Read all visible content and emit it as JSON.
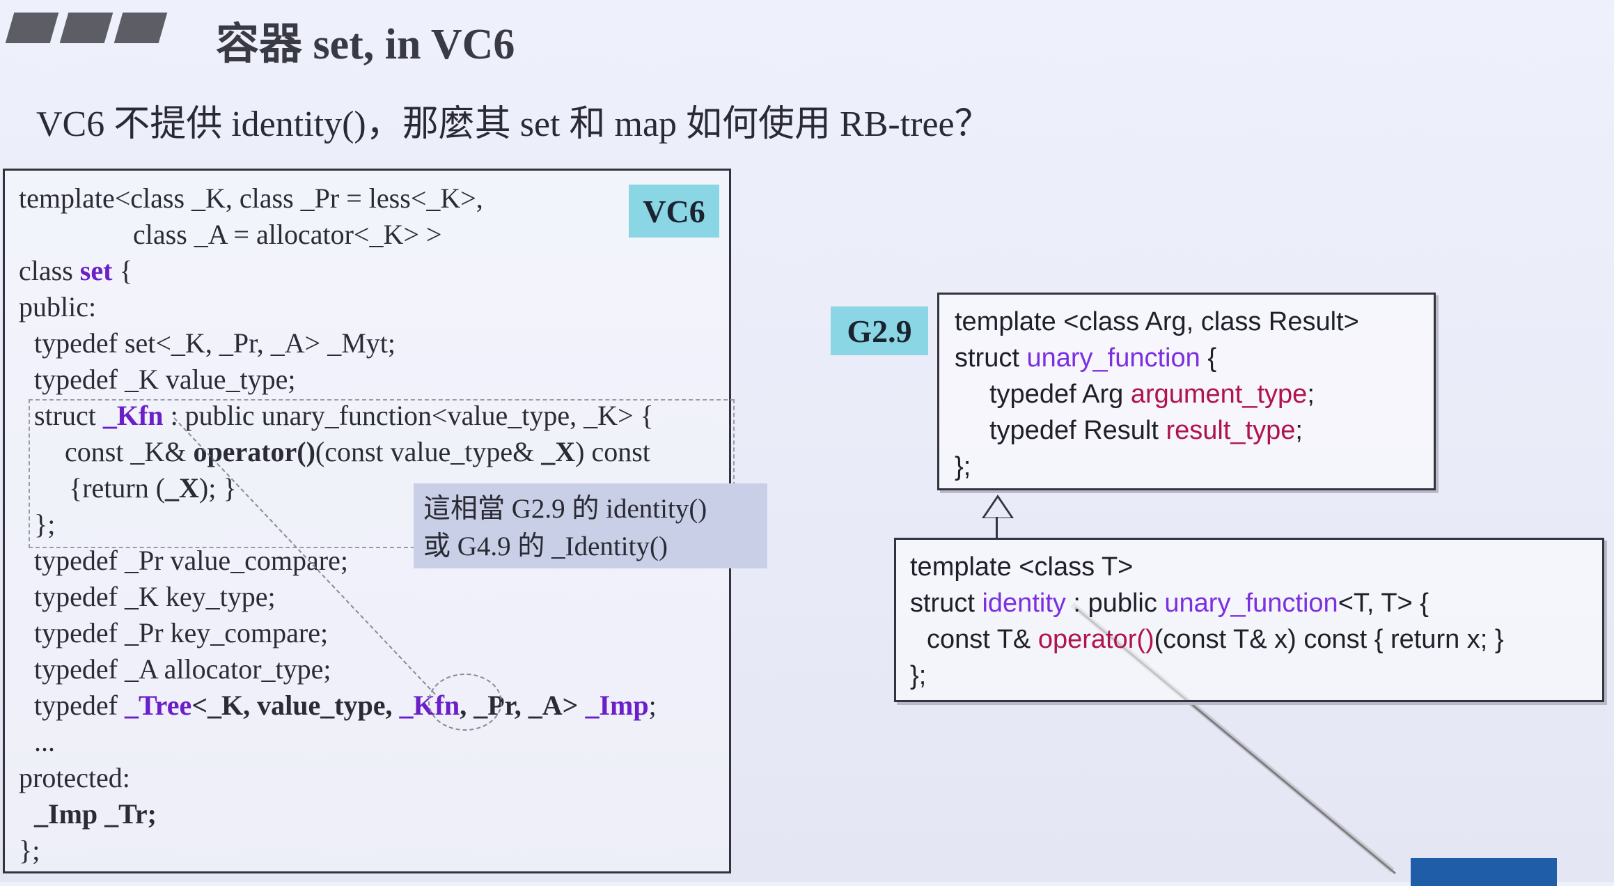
{
  "slide": {
    "title": "容器 set, in VC6",
    "question": "VC6 不提供 identity()，那麼其 set 和 map 如何使用 RB-tree？"
  },
  "left_box": {
    "tag": "VC6",
    "lines": {
      "l1": "template<class _K, class _Pr = less<_K>,",
      "l2": "class _A = allocator<_K> >",
      "l3a": "class ",
      "l3b": "set",
      "l3c": " {",
      "l4": "public:",
      "l5": "typedef set<_K, _Pr, _A> _Myt;",
      "l6": "typedef _K value_type;",
      "l7a": "struct ",
      "l7b": "_Kfn",
      "l7c": " : public unary_function<value_type, _K> {",
      "l8a": "const _K& ",
      "l8b": "operator()",
      "l8c": "(const value_type& ",
      "l8d": "_X",
      "l8e": ") const",
      "l9a": "{return (",
      "l9b": "_X",
      "l9c": "); }",
      "l10": "};",
      "l11": "typedef _Pr value_compare;",
      "l12": "typedef _K key_type;",
      "l13": "typedef _Pr key_compare;",
      "l14": "typedef _A allocator_type;",
      "l15a": "typedef ",
      "l15b": "_Tree",
      "l15c": "<_K, value_type, ",
      "l15d": "_Kfn",
      "l15e": ", _Pr, _A> ",
      "l15f": "_Imp",
      "l15g": ";",
      "l16": "...",
      "l17": "protected:",
      "l18": "_Imp _Tr;",
      "l19": "};"
    }
  },
  "note": {
    "line1": "這相當 G2.9 的 identity()",
    "line2": "或 G4.9 的 _Identity()"
  },
  "right_top": {
    "tag": "G2.9",
    "l1": "template <class Arg, class Result>",
    "l2a": "struct ",
    "l2b": "unary_function",
    "l2c": " {",
    "l3a": "typedef Arg ",
    "l3b": "argument_type",
    "l3c": ";",
    "l4a": "typedef Result ",
    "l4b": "result_type",
    "l4c": ";",
    "l5": "};"
  },
  "right_bottom": {
    "l1": "template <class T>",
    "l2a": "struct ",
    "l2b": "identity",
    "l2c": " : public ",
    "l2d": "unary_function",
    "l2e": "<T, T> {",
    "l3a": "const T& ",
    "l3b": "operator()",
    "l3c": "(const T& x) const { return x; }",
    "l4": "};"
  },
  "colors": {
    "keyword": "#6a1fc8",
    "type_name": "#b0124d",
    "tag_bg": "#8ad6e5",
    "note_bg": "#c8cfe6"
  }
}
